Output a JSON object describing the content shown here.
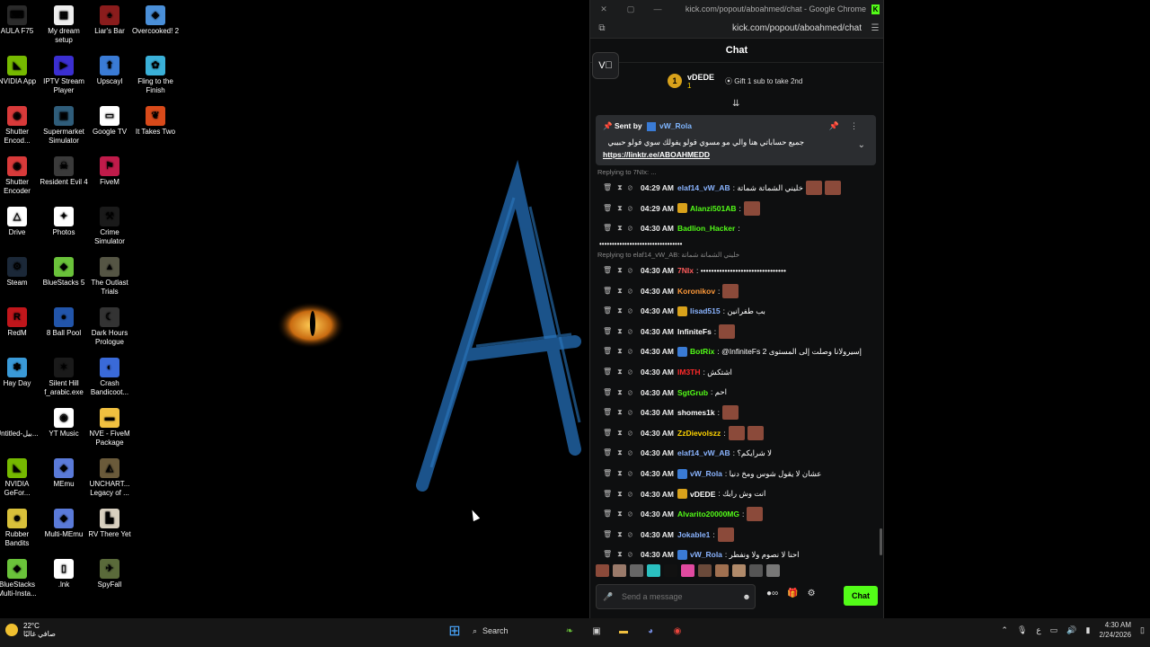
{
  "desktop": {
    "icons": [
      {
        "label": "AULA F75",
        "color": "#2a2a2a",
        "glyph": "⌨"
      },
      {
        "label": "My dream setup",
        "color": "#eeeeee",
        "glyph": "▦"
      },
      {
        "label": "Liar's Bar",
        "color": "#8a1c1c",
        "glyph": "♠"
      },
      {
        "label": "Overcooked! 2",
        "color": "#4a8fd8",
        "glyph": "◈"
      },
      {
        "label": "NVIDIA App",
        "color": "#76b900",
        "glyph": "◣"
      },
      {
        "label": "IPTV Stream Player",
        "color": "#3b2fd1",
        "glyph": "▶"
      },
      {
        "label": "Upscayl",
        "color": "#3a7bd5",
        "glyph": "⬆"
      },
      {
        "label": "Fling to the Finish",
        "color": "#3ab0d8",
        "glyph": "✿"
      },
      {
        "label": "Shutter Encod...",
        "color": "#d83a3a",
        "glyph": "◉"
      },
      {
        "label": "Supermarket Simulator",
        "color": "#2f5d7a",
        "glyph": "▣"
      },
      {
        "label": "Google TV",
        "color": "#ffffff",
        "glyph": "▭"
      },
      {
        "label": "It Takes Two",
        "color": "#d84a1a",
        "glyph": "❦"
      },
      {
        "label": "Shutter Encoder",
        "color": "#d83a3a",
        "glyph": "◉"
      },
      {
        "label": "Resident Evil 4",
        "color": "#3a3a3a",
        "glyph": "☠"
      },
      {
        "label": "FiveM",
        "color": "#c01b4a",
        "glyph": "⚑"
      },
      {
        "label": "Drive",
        "color": "#ffffff",
        "glyph": "△"
      },
      {
        "label": "Photos",
        "color": "#ffffff",
        "glyph": "✦"
      },
      {
        "label": "Crime Simulator",
        "color": "#1a1a1a",
        "glyph": "⚒"
      },
      {
        "label": "Steam",
        "color": "#1b2838",
        "glyph": "⚙"
      },
      {
        "label": "BlueStacks 5",
        "color": "#6ac23a",
        "glyph": "◆"
      },
      {
        "label": "The Outlast Trials",
        "color": "#555544",
        "glyph": "▲"
      },
      {
        "label": "RedM",
        "color": "#c0161b",
        "glyph": "R"
      },
      {
        "label": "8 Ball Pool",
        "color": "#2255aa",
        "glyph": "●"
      },
      {
        "label": "Dark Hours Prologue",
        "color": "#333333",
        "glyph": "☾"
      },
      {
        "label": "Hay Day",
        "color": "#3a9ad8",
        "glyph": "✽"
      },
      {
        "label": "Silent Hill f_arabic.exe",
        "color": "#1a1a1a",
        "glyph": "✶"
      },
      {
        "label": "Crash Bandicoot...",
        "color": "#3a6ad8",
        "glyph": "◐"
      },
      {
        "label": "Untitled-بيل...",
        "color": "#000000",
        "glyph": ""
      },
      {
        "label": "YT Music",
        "color": "#ffffff",
        "glyph": "◉"
      },
      {
        "label": "NVE - FiveM Package",
        "color": "#f0c040",
        "glyph": "▬"
      },
      {
        "label": "NVIDIA GeFor...",
        "color": "#76b900",
        "glyph": "◣"
      },
      {
        "label": "MEmu",
        "color": "#5a7ad8",
        "glyph": "◆"
      },
      {
        "label": "UNCHART... Legacy of ...",
        "color": "#6a5a3a",
        "glyph": "◭"
      },
      {
        "label": "Rubber Bandits",
        "color": "#d8c03a",
        "glyph": "☻"
      },
      {
        "label": "Multi-MEmu",
        "color": "#5a7ad8",
        "glyph": "◆"
      },
      {
        "label": "RV There Yet",
        "color": "#d8d0c0",
        "glyph": "▙"
      },
      {
        "label": "BlueStacks Multi-Insta...",
        "color": "#6ac23a",
        "glyph": "◆"
      },
      {
        "label": ".lnk",
        "color": "#ffffff",
        "glyph": "▯"
      },
      {
        "label": "SpyFall",
        "color": "#5a6a3a",
        "glyph": "✈"
      }
    ]
  },
  "browser": {
    "title": "kick.com/popout/aboahmed/chat - Google Chrome",
    "url": "kick.com/popout/aboahmed/chat"
  },
  "chat": {
    "header": "Chat",
    "leaderboard": {
      "rank": "1",
      "name": "vDEDE",
      "count": "1",
      "gift_text": "Gift 1 sub to take 2nd"
    },
    "pinned": {
      "label": "Sent by",
      "user": "vW_Rola",
      "message": "جميع حساباتي هنا والي مو مسوي فولو يفولك سوي فولو حبيبي",
      "link": "https://linktr.ee/ABOAHMEDD"
    },
    "messages": [
      {
        "time": "04:29 AM",
        "user": "elaf14_vW_AB",
        "user_color": "#8ab4ff",
        "text": ": خليني الشماتة شماتة",
        "badge": "",
        "emotes": 2
      },
      {
        "time": "04:29 AM",
        "user": "Alanzi501AB",
        "user_color": "#53fc18",
        "text": ":",
        "badge": "#d9a21b",
        "emotes": 1
      },
      {
        "time": "04:30 AM",
        "user": "Badlion_Hacker",
        "user_color": "#53fc18",
        "text": ":",
        "badge": "",
        "emotes": 0
      },
      {
        "time": "04:30 AM",
        "user": "7NIx",
        "user_color": "#ff5c5c",
        "text": ": ••••••••••••••••••••••••••••••••",
        "badge": "",
        "emotes": 0
      },
      {
        "time": "04:30 AM",
        "user": "Koronikov",
        "user_color": "#ff9a3a",
        "text": ":",
        "badge": "",
        "emotes": 1
      },
      {
        "time": "04:30 AM",
        "user": "lisad515",
        "user_color": "#8ab4ff",
        "text": ": بب طفرانين",
        "badge": "#d9a21b",
        "emotes": 0
      },
      {
        "time": "04:30 AM",
        "user": "InfiniteFs",
        "user_color": "#ffffff",
        "text": ":",
        "badge": "",
        "emotes": 1
      },
      {
        "time": "04:30 AM",
        "user": "BotRix",
        "user_color": "#53fc18",
        "text": ": @InfiniteFs إسيرولانا وصلت إلى المستوى 2",
        "badge": "#3a7bd5",
        "emotes": 0
      },
      {
        "time": "04:30 AM",
        "user": "IM3TH",
        "user_color": "#ff2a2a",
        "text": ": اشتكش",
        "badge": "",
        "emotes": 0
      },
      {
        "time": "04:30 AM",
        "user": "SgtGrub",
        "user_color": "#53fc18",
        "text": ": احم",
        "badge": "",
        "emotes": 0
      },
      {
        "time": "04:30 AM",
        "user": "shomes1k",
        "user_color": "#ffffff",
        "text": ":",
        "badge": "",
        "emotes": 1
      },
      {
        "time": "04:30 AM",
        "user": "ZzDievolszz",
        "user_color": "#ffd400",
        "text": ":",
        "badge": "",
        "emotes": 2
      },
      {
        "time": "04:30 AM",
        "user": "elaf14_vW_AB",
        "user_color": "#8ab4ff",
        "text": ": لا شرايكم؟",
        "badge": "",
        "emotes": 0
      },
      {
        "time": "04:30 AM",
        "user": "vW_Rola",
        "user_color": "#8ab4ff",
        "text": ": عشان لا يقول شوس ومخ دنيا",
        "badge": "#3a7bd5",
        "emotes": 0
      },
      {
        "time": "04:30 AM",
        "user": "vDEDE",
        "user_color": "#ffffff",
        "text": ": انت وش رايك",
        "badge": "#d9a21b",
        "emotes": 0
      },
      {
        "time": "04:30 AM",
        "user": "Alvarito20000MG",
        "user_color": "#53fc18",
        "text": ":",
        "badge": "",
        "emotes": 1
      },
      {
        "time": "04:30 AM",
        "user": "Jokable1",
        "user_color": "#8ab4ff",
        "text": ":",
        "badge": "",
        "emotes": 1
      },
      {
        "time": "04:30 AM",
        "user": "vW_Rola",
        "user_color": "#8ab4ff",
        "text": ": احنا لا نصوم ولا ونفطر",
        "badge": "#3a7bd5",
        "emotes": 0
      }
    ],
    "reply_first": "Replying to 7NIx: ...",
    "reply_second": "Replying to elaf14_vW_AB: خليني الشماتة شماتة",
    "badlion_continuation": "•••••••••••••••••••••••••••••••••",
    "composer_placeholder": "Send a message",
    "send_label": "Chat"
  },
  "taskbar": {
    "weather_temp": "22°C",
    "weather_desc": "صافي غالبًا",
    "search_label": "Search",
    "time": "4:30 AM",
    "date": "2/24/2026",
    "lang": "ع"
  },
  "colors": {
    "kick_green": "#53fc18",
    "wallpaper_accent": "#1e5c9a",
    "eye": "#e08a1a"
  }
}
